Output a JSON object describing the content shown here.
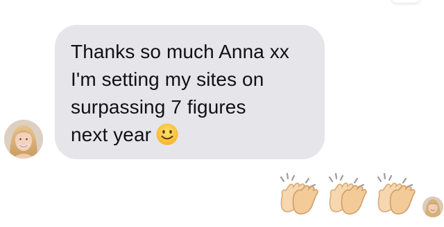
{
  "message": {
    "lines": [
      "Thanks so much Anna xx",
      "I'm setting my sites on",
      "surpassing 7 figures",
      "next year"
    ],
    "emoji": "slightly-smiling-face-emoji",
    "bubble_color": "#e5e5ea",
    "text_color": "#111111"
  },
  "reactions": {
    "items": [
      "clapping-hands-emoji",
      "clapping-hands-emoji",
      "clapping-hands-emoji"
    ]
  },
  "avatars": {
    "sender_icon": "profile-photo-icon",
    "read_receipt_icon": "profile-photo-icon"
  }
}
